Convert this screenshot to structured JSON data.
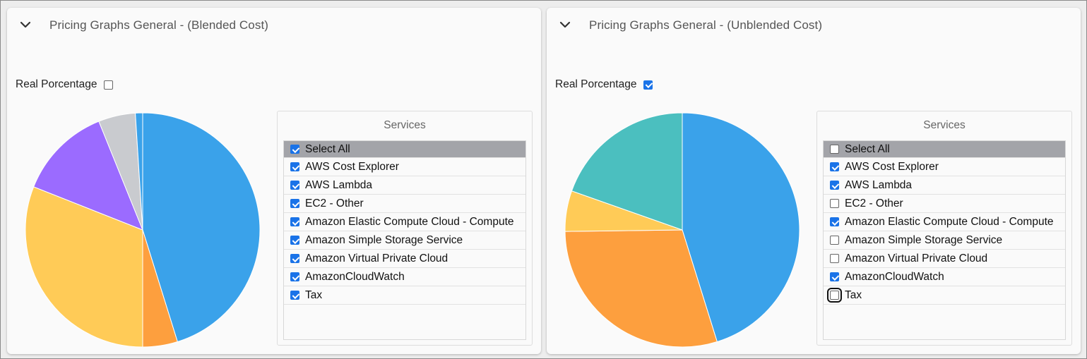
{
  "panels": [
    {
      "title": "Pricing Graphs General - (Blended Cost)",
      "real_percentage": {
        "label": "Real Porcentage",
        "checked": false
      },
      "services_title": "Services",
      "select_all": {
        "label": "Select All",
        "checked": true
      },
      "services": [
        {
          "label": "AWS Cost Explorer",
          "checked": true
        },
        {
          "label": "AWS Lambda",
          "checked": true
        },
        {
          "label": "EC2 - Other",
          "checked": true
        },
        {
          "label": "Amazon Elastic Compute Cloud - Compute",
          "checked": true
        },
        {
          "label": "Amazon Simple Storage Service",
          "checked": true
        },
        {
          "label": "Amazon Virtual Private Cloud",
          "checked": true
        },
        {
          "label": "AmazonCloudWatch",
          "checked": true
        },
        {
          "label": "Tax",
          "checked": true
        }
      ],
      "chart_data": {
        "type": "pie",
        "slices": [
          {
            "value": 45.2,
            "color": "#3aa2ea"
          },
          {
            "value": 4.8,
            "color": "#fd9f3e"
          },
          {
            "value": 31.0,
            "color": "#ffcb57"
          },
          {
            "value": 12.9,
            "color": "#9b6bff"
          },
          {
            "value": 5.1,
            "color": "#c9cbcf"
          },
          {
            "value": 1.0,
            "color": "#3aa2ea"
          }
        ]
      }
    },
    {
      "title": "Pricing Graphs General - (Unblended Cost)",
      "real_percentage": {
        "label": "Real Porcentage",
        "checked": true
      },
      "services_title": "Services",
      "select_all": {
        "label": "Select All",
        "checked": false
      },
      "services": [
        {
          "label": "AWS Cost Explorer",
          "checked": true
        },
        {
          "label": "AWS Lambda",
          "checked": true
        },
        {
          "label": "EC2 - Other",
          "checked": false
        },
        {
          "label": "Amazon Elastic Compute Cloud - Compute",
          "checked": true
        },
        {
          "label": "Amazon Simple Storage Service",
          "checked": false
        },
        {
          "label": "Amazon Virtual Private Cloud",
          "checked": false
        },
        {
          "label": "AmazonCloudWatch",
          "checked": true
        },
        {
          "label": "Tax",
          "checked": false,
          "focused": true
        }
      ],
      "chart_data": {
        "type": "pie",
        "slices": [
          {
            "value": 45.2,
            "color": "#3aa2ea"
          },
          {
            "value": 29.6,
            "color": "#fd9f3e"
          },
          {
            "value": 5.6,
            "color": "#ffcb57"
          },
          {
            "value": 19.6,
            "color": "#4bbfbf"
          }
        ]
      }
    }
  ]
}
